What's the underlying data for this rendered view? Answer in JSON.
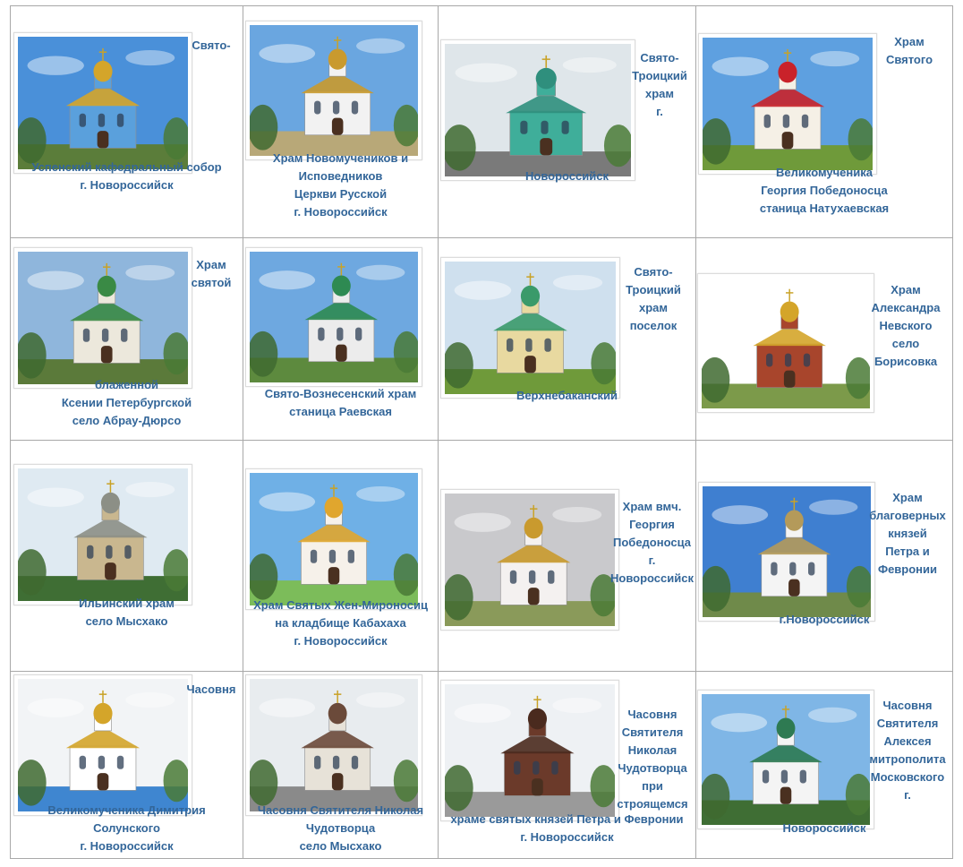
{
  "cells": [
    {
      "side": [
        "Свято-"
      ],
      "bottom": [
        "Успенский кафедральный собор",
        "г. Новороссийск"
      ],
      "photo": "church-photo-uspensky",
      "colors": {
        "sky": "#4a90d9",
        "wall": "#5aa0dc",
        "dome": "#d4a52a",
        "ground": "#5b7d3a"
      }
    },
    {
      "side": [],
      "bottom": [
        "Храм Новомучеников и",
        "Исповедников",
        "Церкви Русской",
        "г. Новороссийск"
      ],
      "photo": "church-photo-novomuchenikov",
      "colors": {
        "sky": "#6aa6e0",
        "wall": "#f2f2f2",
        "dome": "#c99a2e",
        "ground": "#b8a878"
      }
    },
    {
      "side": [
        "Свято-",
        "Троицкий",
        "храм",
        "г."
      ],
      "bottom": [
        "Новороссийск"
      ],
      "photo": "church-photo-troitsky",
      "colors": {
        "sky": "#dfe6ea",
        "wall": "#3fae9a",
        "dome": "#2f8f7d",
        "ground": "#7a7a7a"
      }
    },
    {
      "side": [
        "Храм",
        "Святого"
      ],
      "bottom": [
        "Великомученика",
        "Георгия Победоносца",
        "станица Натухаевская"
      ],
      "photo": "church-photo-georgiya",
      "colors": {
        "sky": "#5ea0e0",
        "wall": "#f5f0e6",
        "dome": "#c9222a",
        "ground": "#6f9a3a"
      }
    },
    {
      "side": [
        "Храм",
        "святой"
      ],
      "bottom": [
        "блаженной",
        "Ксении Петербургской",
        "село Абрау-Дюрсо"
      ],
      "photo": "church-photo-ksenii",
      "colors": {
        "sky": "#8fb6dc",
        "wall": "#ece8dc",
        "dome": "#3a8a45",
        "ground": "#5b7a3a"
      }
    },
    {
      "side": [],
      "bottom": [
        "Свято-Вознесенский храм",
        "станица Раевская"
      ],
      "photo": "church-photo-voznesensky",
      "colors": {
        "sky": "#6ea8e0",
        "wall": "#ececec",
        "dome": "#2e8a52",
        "ground": "#5d8a3e"
      }
    },
    {
      "side": [
        "Свято-",
        "Троицкий",
        "храм",
        "поселок"
      ],
      "bottom": [
        "Верхнебаканский"
      ],
      "photo": "church-photo-verkhnebakansky",
      "colors": {
        "sky": "#cfe0ee",
        "wall": "#e8d9a0",
        "dome": "#3a9a6a",
        "ground": "#6f9a3a"
      }
    },
    {
      "side": [
        "Храм",
        "Александра",
        "Невского",
        "село",
        "Борисовка"
      ],
      "bottom": [],
      "photo": "church-photo-nevskogo",
      "colors": {
        "sky": "#ffffff",
        "wall": "#a8452c",
        "dome": "#d4a52a",
        "ground": "#7c9a4a"
      }
    },
    {
      "side": [],
      "bottom": [
        "Ильинский храм",
        "село Мысхако"
      ],
      "photo": "church-photo-ilyinsky",
      "colors": {
        "sky": "#dfeaf2",
        "wall": "#c9b78f",
        "dome": "#8c8f86",
        "ground": "#3f6e34"
      }
    },
    {
      "side": [],
      "bottom": [
        "Храм Святых Жен-Мироносиц",
        "на кладбище Кабахаха",
        "г. Новороссийск"
      ],
      "photo": "church-photo-mironosits",
      "colors": {
        "sky": "#6fb0e6",
        "wall": "#f6f1ea",
        "dome": "#e0a62e",
        "ground": "#7cbc5a"
      }
    },
    {
      "side": [
        "Храм вмч.",
        "Георгия",
        "Победоносца",
        "г.",
        "Новороссийск"
      ],
      "bottom": [],
      "photo": "church-photo-georgiya-pobedonostsa",
      "colors": {
        "sky": "#c9c9cc",
        "wall": "#f4f1f0",
        "dome": "#c99a2e",
        "ground": "#8a9a5a"
      }
    },
    {
      "side": [
        "Храм",
        "благоверных",
        "князей",
        "Петра и",
        "Февронии"
      ],
      "bottom": [
        "г.Новороссийск"
      ],
      "photo": "church-photo-petra-fevronii",
      "colors": {
        "sky": "#3f7fd0",
        "wall": "#f4f4f4",
        "dome": "#b49a5a",
        "ground": "#6f8a4a"
      }
    },
    {
      "side": [
        "Часовня"
      ],
      "bottom": [
        "Великомученика Димитрия",
        "Солунского",
        "г. Новороссийск"
      ],
      "photo": "chapel-photo-dimitriya",
      "colors": {
        "sky": "#f2f4f6",
        "wall": "#ffffff",
        "dome": "#d4a52a",
        "ground": "#3f86d0"
      }
    },
    {
      "side": [],
      "bottom": [
        "Часовня Святителя Николая",
        "Чудотворца",
        "село Мысхако"
      ],
      "photo": "chapel-photo-nikolaya",
      "colors": {
        "sky": "#e8ecef",
        "wall": "#e7e2d8",
        "dome": "#6b4a3a",
        "ground": "#8a8a8a"
      }
    },
    {
      "side": [
        "Часовня",
        "Святителя",
        "Николая",
        "Чудотворца",
        "при",
        "строящемся"
      ],
      "bottom": [
        "храме святых князей Петра и Февронии",
        "г. Новороссийск"
      ],
      "photo": "chapel-photo-stroyashchemsya",
      "colors": {
        "sky": "#eef1f4",
        "wall": "#6b3a2a",
        "dome": "#4a2a1e",
        "ground": "#9a9a9a"
      }
    },
    {
      "side": [
        "Часовня",
        "Святителя",
        "Алексея",
        "митрополита",
        "Московского",
        "г."
      ],
      "bottom": [
        "Новороссийск"
      ],
      "photo": "chapel-photo-alekseya",
      "colors": {
        "sky": "#7fb6e6",
        "wall": "#f4f4f4",
        "dome": "#2e7a52",
        "ground": "#3f6e34"
      }
    }
  ]
}
